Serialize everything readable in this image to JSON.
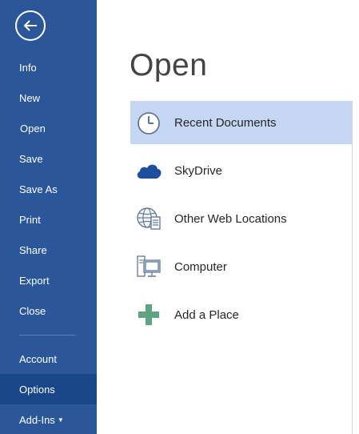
{
  "sidebar": {
    "back_label": "Back",
    "items": [
      {
        "label": "Info"
      },
      {
        "label": "New"
      },
      {
        "label": "Open"
      },
      {
        "label": "Save"
      },
      {
        "label": "Save As"
      },
      {
        "label": "Print"
      },
      {
        "label": "Share"
      },
      {
        "label": "Export"
      },
      {
        "label": "Close"
      },
      {
        "label": "Account"
      },
      {
        "label": "Options"
      },
      {
        "label": "Add-Ins"
      }
    ],
    "selected_item": "Options"
  },
  "main": {
    "title": "Open",
    "places": [
      {
        "label": "Recent Documents",
        "icon": "clock-icon",
        "selected": true
      },
      {
        "label": "SkyDrive",
        "icon": "cloud-icon"
      },
      {
        "label": "Other Web Locations",
        "icon": "globe-icon"
      },
      {
        "label": "Computer",
        "icon": "computer-icon"
      },
      {
        "label": "Add a Place",
        "icon": "plus-icon"
      }
    ]
  },
  "colors": {
    "sidebar_bg": "#2b579a",
    "sidebar_selected": "#19478a",
    "place_selected": "#c5d7f2",
    "accent_blue": "#2b579a",
    "plus_green": "#5fa383"
  }
}
